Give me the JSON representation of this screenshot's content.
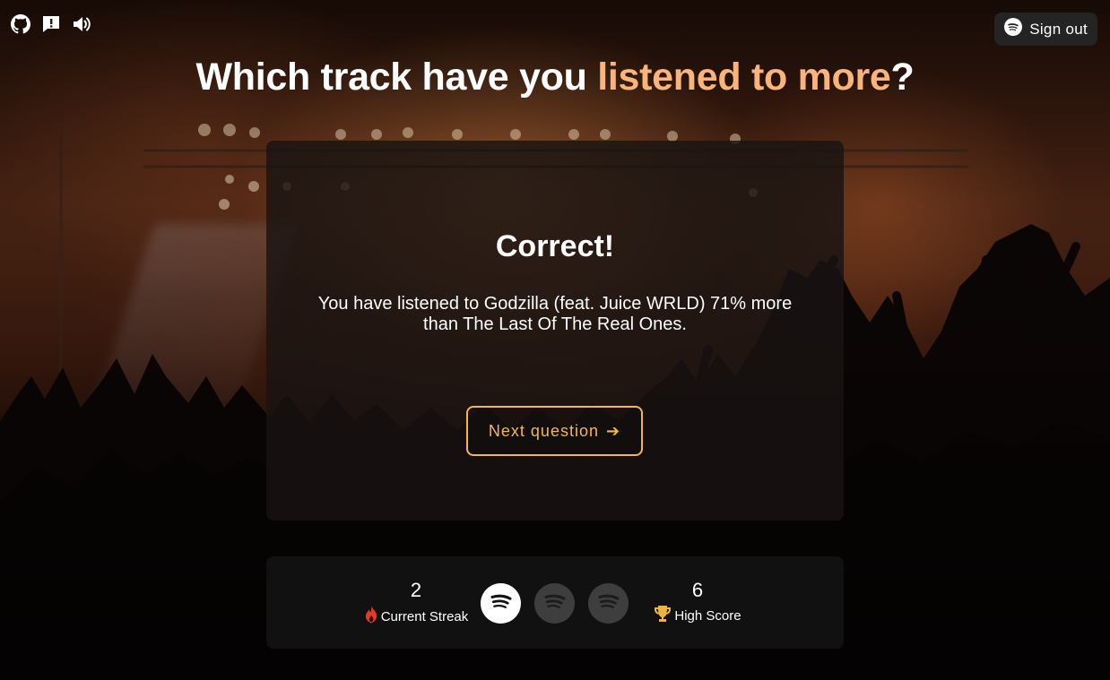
{
  "header": {
    "icons": [
      "github-icon",
      "feedback-icon",
      "volume-icon"
    ],
    "sign_out_label": "Sign out",
    "sign_out_icon": "spotify-icon"
  },
  "heading": {
    "prefix": "Which track have you ",
    "highlight": "listened to more",
    "suffix": "?",
    "highlight_color": "#f8b47a"
  },
  "result": {
    "title": "Correct!",
    "message": "You have listened to Godzilla (feat. Juice WRLD) 71% more than The Last Of The Real Ones.",
    "next_label": "Next question",
    "next_arrow": "➔",
    "button_color": "#f6b64a"
  },
  "stats": {
    "current_streak": {
      "value": "2",
      "label": "Current Streak",
      "icon": "fire-icon"
    },
    "high_score": {
      "value": "6",
      "label": "High Score",
      "icon": "trophy-icon"
    },
    "lives": {
      "total": 3,
      "remaining": 1,
      "icon": "spotify-icon"
    }
  }
}
